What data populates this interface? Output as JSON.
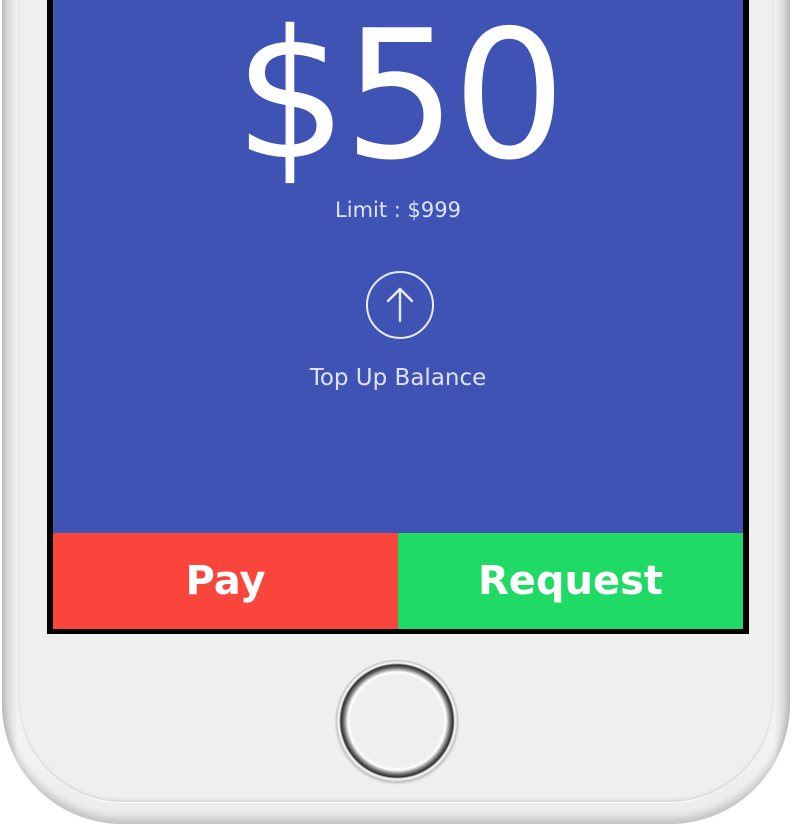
{
  "wallet": {
    "balance": "$50",
    "limit": "Limit : $999",
    "top_up_label": "Top Up Balance"
  },
  "actions": {
    "pay_label": "Pay",
    "request_label": "Request"
  },
  "colors": {
    "background": "#3f53b5",
    "pay": "#f9453b",
    "request": "#1fda65",
    "text": "#ffffff"
  },
  "icons": {
    "top_up": "arrow-up-circle-icon",
    "home": "home-button"
  }
}
